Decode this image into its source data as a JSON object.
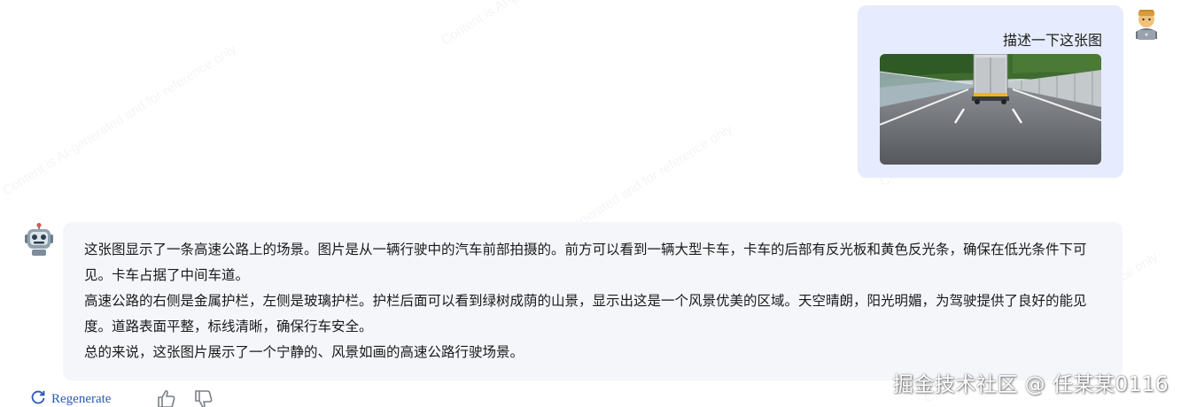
{
  "watermark_text": "Content is AI-generated and for reference only",
  "user_message": {
    "text": "描述一下这张图",
    "avatar": "person-laptop-icon",
    "image": "highway-truck-photo"
  },
  "bot_message": {
    "avatar": "robot-icon",
    "paragraphs": [
      "这张图显示了一条高速公路上的场景。图片是从一辆行驶中的汽车前部拍摄的。前方可以看到一辆大型卡车，卡车的后部有反光板和黄色反光条，确保在低光条件下可见。卡车占据了中间车道。",
      "高速公路的右侧是金属护栏，左侧是玻璃护栏。护栏后面可以看到绿树成荫的山景，显示出这是一个风景优美的区域。天空晴朗，阳光明媚，为驾驶提供了良好的能见度。道路表面平整，标线清晰，确保行车安全。",
      "总的来说，这张图片展示了一个宁静的、风景如画的高速公路行驶场景。"
    ]
  },
  "actions": {
    "regenerate_label": "Regenerate",
    "thumbs_up": "thumbs-up-icon",
    "thumbs_down": "thumbs-down-icon"
  },
  "credit": "掘金技术社区 @ 任某某0116",
  "colors": {
    "user_bubble": "#e6ecfd",
    "bot_bubble": "#f4f6fa",
    "link": "#2a59b8"
  }
}
